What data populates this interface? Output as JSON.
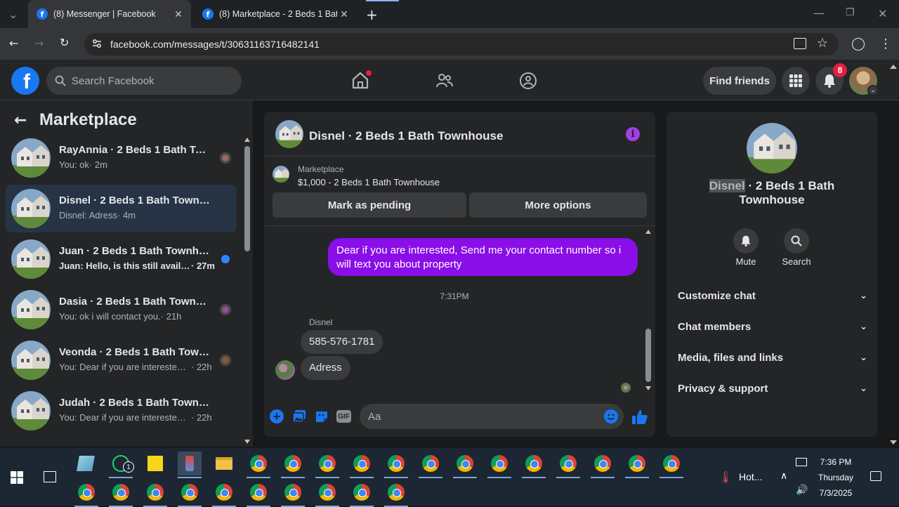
{
  "browser": {
    "tabs": [
      {
        "title": "(8) Messenger | Facebook",
        "active": true
      },
      {
        "title": "(8) Marketplace - 2 Beds 1 Bath",
        "active": false
      }
    ],
    "url": "facebook.com/messages/t/30631163716482141"
  },
  "header": {
    "search_placeholder": "Search Facebook",
    "find_friends": "Find friends",
    "notification_count": "8"
  },
  "sidebar": {
    "title": "Marketplace",
    "conversations": [
      {
        "name": "RayAnnia · 2 Beds 1 Bath Tow...",
        "preview": "You: ok",
        "time": "· 2m",
        "unread": false,
        "selected": false
      },
      {
        "name": "Disnel · 2 Beds 1 Bath Townhouse",
        "preview": "Disnel: Adress",
        "time": "· 4m",
        "unread": false,
        "selected": true
      },
      {
        "name": "Juan · 2 Beds 1 Bath Townhouse",
        "preview": "Juan: Hello, is this still availabl...",
        "time": "· 27m",
        "unread": true,
        "selected": false
      },
      {
        "name": "Dasia · 2 Beds 1 Bath Townho...",
        "preview": "You: ok i will contact you.",
        "time": "· 21h",
        "unread": false,
        "selected": false
      },
      {
        "name": "Veonda · 2 Beds 1 Bath Townh...",
        "preview": "You: Dear if you are interested, ...",
        "time": "· 22h",
        "unread": false,
        "selected": false
      },
      {
        "name": "Judah · 2 Beds 1 Bath Townhouse",
        "preview": "You: Dear if you are interested, Se...",
        "time": "· 22h",
        "unread": false,
        "selected": false
      }
    ]
  },
  "chat": {
    "title": "Disnel · 2 Beds 1 Bath Townhouse",
    "listing_label": "Marketplace",
    "listing_detail": "$1,000 - 2 Beds 1 Bath Townhouse",
    "mark_pending": "Mark as pending",
    "more_options": "More options",
    "outgoing_message": "Dear if you are interested, Send me your contact number so i will text you about property",
    "timestamp": "7:31PM",
    "sender_name": "Disnel",
    "incoming": [
      "585-576-1781",
      "Adress"
    ],
    "composer_placeholder": "Aa"
  },
  "info_panel": {
    "name_highlight": "Disnel",
    "name_rest": " · 2 Beds 1 Bath",
    "name_line2": "Townhouse",
    "mute": "Mute",
    "search": "Search",
    "sections": [
      "Customize chat",
      "Chat members",
      "Media, files and links",
      "Privacy & support"
    ]
  },
  "taskbar": {
    "weather": "Hot...",
    "time": "7:36 PM",
    "day": "Thursday",
    "date": "7/3/2025",
    "whatsapp_badge": "1"
  },
  "colors": {
    "accent": "#1877f2",
    "outgoing_bubble": "#8a0ee8",
    "info_icon": "#a53ee6",
    "selected_row": "#263445",
    "badge": "#e41e3f"
  }
}
